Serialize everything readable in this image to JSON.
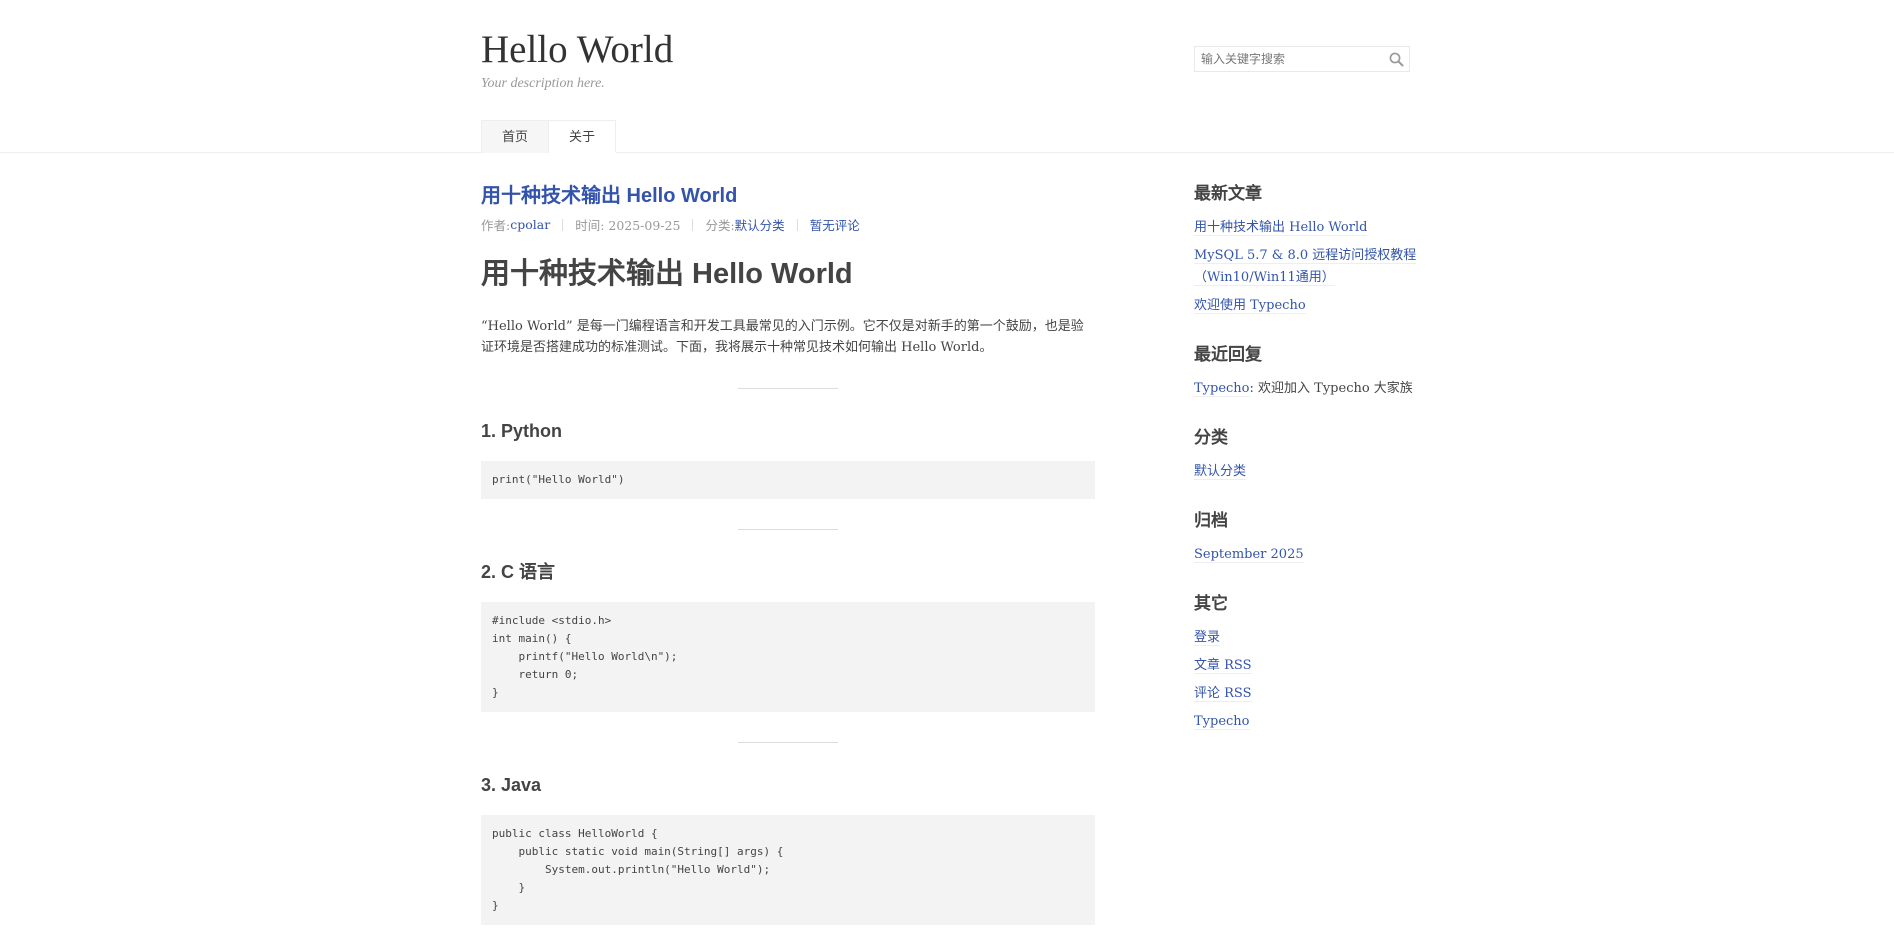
{
  "site": {
    "title": "Hello World",
    "description": "Your description here."
  },
  "search": {
    "placeholder": "输入关键字搜索"
  },
  "nav": {
    "items": [
      {
        "label": "首页"
      },
      {
        "label": "关于"
      }
    ]
  },
  "post": {
    "title": "用十种技术输出 Hello World",
    "meta": {
      "author_label": "作者: ",
      "author": "cpolar",
      "time": "时间: 2025-09-25",
      "category_label": "分类: ",
      "category": "默认分类",
      "comments": "暂无评论"
    },
    "heading": "用十种技术输出 Hello World",
    "intro": "“Hello World” 是每一门编程语言和开发工具最常见的入门示例。它不仅是对新手的第一个鼓励，也是验证环境是否搭建成功的标准测试。下面，我将展示十种常见技术如何输出 Hello World。",
    "sections": [
      {
        "title": "1. Python",
        "code": "print(\"Hello World\")"
      },
      {
        "title": "2. C 语言",
        "code": "#include <stdio.h>\nint main() {\n    printf(\"Hello World\\n\");\n    return 0;\n}"
      },
      {
        "title": "3. Java",
        "code": "public class HelloWorld {\n    public static void main(String[] args) {\n        System.out.println(\"Hello World\");\n    }\n}"
      }
    ]
  },
  "sidebar": {
    "recent_posts": {
      "title": "最新文章",
      "items": [
        {
          "label": "用十种技术输出 Hello World"
        },
        {
          "label": "MySQL 5.7 & 8.0 远程访问授权教程（Win10/Win11通用）"
        },
        {
          "label": "欢迎使用 Typecho"
        }
      ]
    },
    "recent_comments": {
      "title": "最近回复",
      "items": [
        {
          "author": "Typecho",
          "text": ": 欢迎加入 Typecho 大家族"
        }
      ]
    },
    "categories": {
      "title": "分类",
      "items": [
        {
          "label": "默认分类"
        }
      ]
    },
    "archives": {
      "title": "归档",
      "items": [
        {
          "label": "September 2025"
        }
      ]
    },
    "other": {
      "title": "其它",
      "items": [
        {
          "label": "登录"
        },
        {
          "label": "文章 RSS"
        },
        {
          "label": "评论 RSS"
        },
        {
          "label": "Typecho"
        }
      ]
    }
  },
  "icons": {
    "search": "search-icon"
  },
  "colors": {
    "link": "#3354aa",
    "text": "#444444",
    "muted": "#999999",
    "code_bg": "#f3f3f3"
  }
}
